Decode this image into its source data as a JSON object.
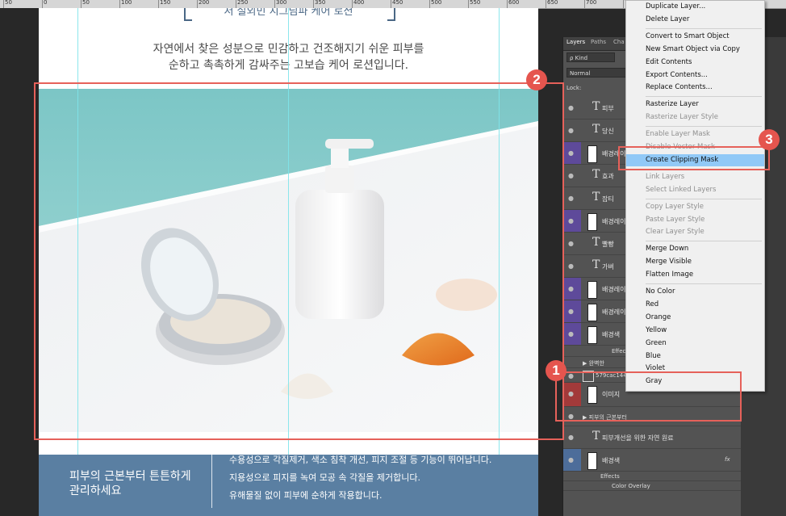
{
  "ruler": {
    "labels": [
      "50",
      "0",
      "50",
      "100",
      "150",
      "200",
      "250",
      "300",
      "350",
      "400",
      "450",
      "500",
      "550",
      "600",
      "650",
      "700",
      "750"
    ]
  },
  "document": {
    "header_partial": "저 실외민 지그님파 케어 로션",
    "desc_line1": "자연에서 찾은 성분으로 민감하고 건조해지기 쉬운 피부를",
    "desc_line2": "순하고 촉촉하게 감싸주는 고보습 케어 로션입니다.",
    "bottom_title_line1": "피부의 근본부터 튼튼하게",
    "bottom_title_line2": "관리하세요",
    "bottom_text": [
      "수용성으로 각질제거, 색소 침착 개선, 피지 조절 등 기능이 뛰어납니다.",
      "지용성으로 피지를 녹여 모공 속 각질을 제거합니다.",
      "유해물질 없이 피부에 순하게 작용합니다."
    ],
    "colors": {
      "band": "#5a7fa2",
      "guide": "#7fe4ea"
    }
  },
  "panel": {
    "tabs": [
      "Layers",
      "Paths",
      "Cha"
    ],
    "filter_label": "ρ Kind",
    "blend_mode": "Normal",
    "lock_label": "Lock:",
    "layers": [
      {
        "type": "text",
        "name": "피부"
      },
      {
        "type": "text",
        "name": "당신"
      },
      {
        "type": "shape",
        "name": "배경레이"
      },
      {
        "type": "text",
        "name": "효과"
      },
      {
        "type": "text",
        "name": "잡티"
      },
      {
        "type": "shape",
        "name": "배경레이"
      },
      {
        "type": "text",
        "name": "빨빵"
      },
      {
        "type": "text",
        "name": "가벼"
      },
      {
        "type": "shape",
        "name": "배경레이"
      },
      {
        "type": "shape",
        "name": "배경레이"
      },
      {
        "type": "shape",
        "name": "배경색"
      }
    ],
    "effects_label": "Effects",
    "group_label": "완벽한",
    "smart_object_name": "579cac14453658f5f9425562503b954 (1)",
    "image_layer": "이미지",
    "bottom_group": "피부의 근본부터",
    "bottom_text_layer": "피부개선을 위한 자연 원료",
    "bg_layer": "배경색",
    "bg_effects": "Effects",
    "bg_color_overlay": "Color Overlay",
    "fx_label": "fx"
  },
  "menu": {
    "items": [
      {
        "label": "Duplicate Layer...",
        "enabled": true
      },
      {
        "label": "Delete Layer",
        "enabled": true
      },
      {
        "sep": true
      },
      {
        "label": "Convert to Smart Object",
        "enabled": true
      },
      {
        "label": "New Smart Object via Copy",
        "enabled": true
      },
      {
        "label": "Edit Contents",
        "enabled": true
      },
      {
        "label": "Export Contents...",
        "enabled": true
      },
      {
        "label": "Replace Contents...",
        "enabled": true
      },
      {
        "sep": true
      },
      {
        "label": "Rasterize Layer",
        "enabled": true
      },
      {
        "label": "Rasterize Layer Style",
        "enabled": false
      },
      {
        "sep": true
      },
      {
        "label": "Enable Layer Mask",
        "enabled": false
      },
      {
        "label": "Disable Vector Mask",
        "enabled": false
      },
      {
        "label": "Create Clipping Mask",
        "enabled": true,
        "highlight": true
      },
      {
        "sep": true
      },
      {
        "label": "Link Layers",
        "enabled": false
      },
      {
        "label": "Select Linked Layers",
        "enabled": false
      },
      {
        "sep": true
      },
      {
        "label": "Copy Layer Style",
        "enabled": false
      },
      {
        "label": "Paste Layer Style",
        "enabled": false
      },
      {
        "label": "Clear Layer Style",
        "enabled": false
      },
      {
        "sep": true
      },
      {
        "label": "Merge Down",
        "enabled": true
      },
      {
        "label": "Merge Visible",
        "enabled": true
      },
      {
        "label": "Flatten Image",
        "enabled": true
      },
      {
        "sep": true
      },
      {
        "label": "No Color",
        "enabled": true
      },
      {
        "label": "Red",
        "enabled": true
      },
      {
        "label": "Orange",
        "enabled": true
      },
      {
        "label": "Yellow",
        "enabled": true
      },
      {
        "label": "Green",
        "enabled": true
      },
      {
        "label": "Blue",
        "enabled": true
      },
      {
        "label": "Violet",
        "enabled": true
      },
      {
        "label": "Gray",
        "enabled": true
      }
    ]
  },
  "annotations": {
    "badge1": "1",
    "badge2": "2",
    "badge3": "3",
    "color": "#e6615a"
  }
}
